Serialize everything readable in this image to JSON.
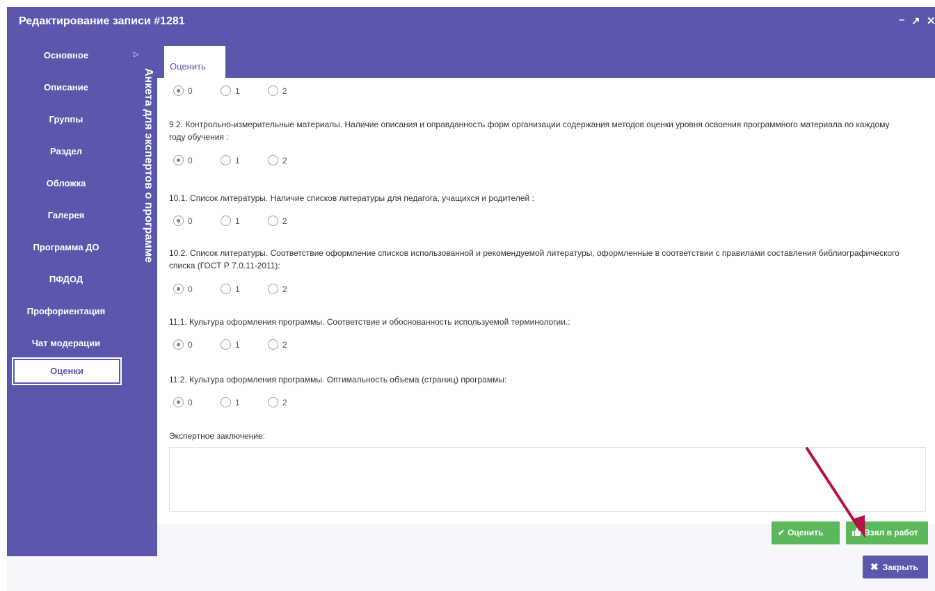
{
  "window": {
    "title": "Редактирование записи #1281",
    "controls": {
      "minimize": "–",
      "maximize": "↗",
      "close": "✕"
    }
  },
  "sidebar": {
    "vertical_title": "Анкета для экспертов о программе",
    "items": [
      {
        "label": "Основное"
      },
      {
        "label": "Описание"
      },
      {
        "label": "Группы"
      },
      {
        "label": "Раздел"
      },
      {
        "label": "Обложка"
      },
      {
        "label": "Галерея"
      },
      {
        "label": "Программа ДО"
      },
      {
        "label": "ПФДОД"
      },
      {
        "label": "Профориентация"
      },
      {
        "label": "Чат модерации"
      },
      {
        "label": "Оценки"
      }
    ],
    "active_item": "Оценки",
    "caret_icon": "caret-right-icon"
  },
  "tab": {
    "label": "Оценить"
  },
  "form": {
    "radio_options": [
      "0",
      "1",
      "2"
    ],
    "questions": [
      {
        "text": "",
        "selected": "0"
      },
      {
        "text": "9.2. Контрольно-измерительные материалы. Наличие описания и оправданность форм организации содержания методов оценки уровня освоения программного материала по каждому году обучения :",
        "selected": "0"
      },
      {
        "text": "10.1. Список литературы. Наличие списков литературы для педагога, учащихся и родителей :",
        "selected": "0"
      },
      {
        "text": "10.2. Список литературы. Соответствие оформление списков использованной и рекомендуемой литературы, оформленные в соответствии с правилами составления библиографического списка (ГОСТ Р 7.0.11-2011):",
        "selected": "0"
      },
      {
        "text": "11.1. Культура оформления программы. Соответствие и обоснованность используемой терминологии.:",
        "selected": "0"
      },
      {
        "text": "11.2. Культура оформления программы. Оптимальность объема (страниц) программы:",
        "selected": "0"
      }
    ],
    "conclusion_label": "Экспертное заключение:",
    "conclusion_value": ""
  },
  "buttons": {
    "rate": {
      "label": "Оценить",
      "icon": "check-icon"
    },
    "take": {
      "label": "Взял в работ",
      "icon": "thumbs-up-icon"
    },
    "close": {
      "label": "Закрыть",
      "icon": "close-icon"
    }
  },
  "colors": {
    "accent": "#5b57ad",
    "success": "#5cb85c",
    "annotation_arrow": "#b3133f"
  }
}
